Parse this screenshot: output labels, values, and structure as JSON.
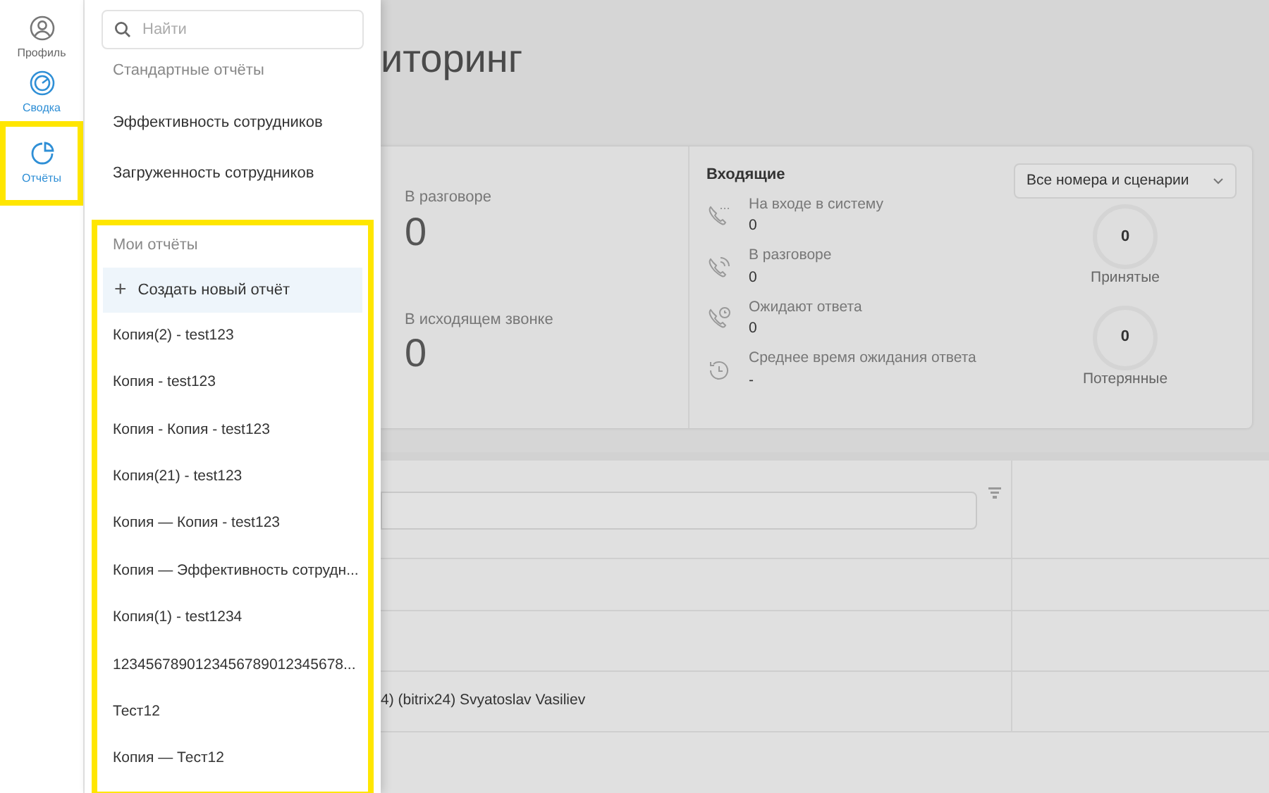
{
  "rail": {
    "items": [
      {
        "label": "Профиль",
        "kind": "profile",
        "active": false,
        "highlighted": false
      },
      {
        "label": "Сводка",
        "kind": "summary",
        "active": true,
        "highlighted": false
      },
      {
        "label": "Отчёты",
        "kind": "reports",
        "active": true,
        "highlighted": true
      }
    ]
  },
  "menu": {
    "search": {
      "placeholder": "Найти"
    },
    "standard": {
      "heading": "Стандартные отчёты",
      "items": [
        "Эффективность сотрудников",
        "Загруженность сотрудников"
      ]
    },
    "mine": {
      "heading": "Мои отчёты",
      "highlighted": true,
      "create": {
        "icon": "+",
        "label": "Создать новый отчёт"
      },
      "items": [
        "Копия(2) - test123",
        "Копия - test123",
        "Копия - Копия - test123",
        "Копия(21) - test123",
        "Копия — Копия - test123",
        "Копия — Эффективность сотрудн...",
        "Копия(1) - test1234",
        "1234567890123456789012345678...",
        "Тест12",
        "Копия — Тест12"
      ]
    }
  },
  "page": {
    "title": "иторинг",
    "outgoing": [
      {
        "label": "В разговоре",
        "value": "0"
      },
      {
        "label": "В исходящем звонке",
        "value": "0"
      }
    ],
    "incoming": {
      "title": "Входящие",
      "select": "Все номера и сценарии",
      "stats": [
        {
          "kind": "queue",
          "label": "На входе в систему",
          "value": "0"
        },
        {
          "kind": "talk",
          "label": "В разговоре",
          "value": "0"
        },
        {
          "kind": "wait",
          "label": "Ожидают ответа",
          "value": "0"
        },
        {
          "kind": "history",
          "label": "Среднее время ожидания ответа",
          "value": "-"
        }
      ],
      "rings": [
        {
          "value": "0",
          "label": "Принятые"
        },
        {
          "value": "0",
          "label": "Потерянные"
        }
      ]
    },
    "table": {
      "rows": [
        "",
        "",
        "4) (bitrix24) Svyatoslav Vasiliev"
      ]
    }
  }
}
